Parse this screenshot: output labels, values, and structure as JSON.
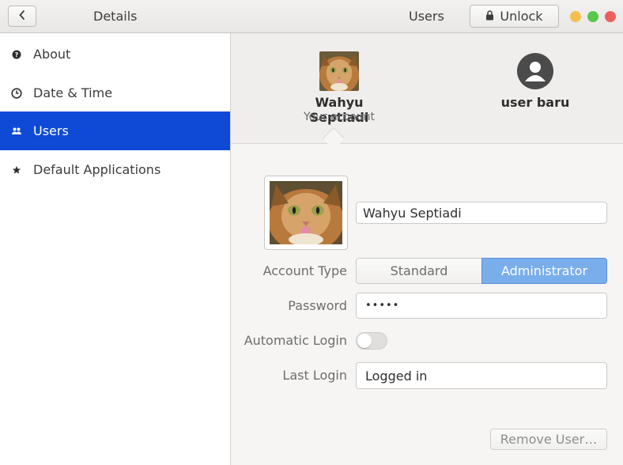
{
  "header": {
    "back_icon": "chevron-left-icon",
    "panel_title": "Details",
    "page_title": "Users",
    "unlock_label": "Unlock",
    "lock_icon": "lock-icon",
    "window_controls": {
      "minimize_color": "#f4bf4f",
      "maximize_color": "#58c84a",
      "close_color": "#ec5f5f"
    }
  },
  "sidebar": {
    "selected_color": "#0e4ad6",
    "items": [
      {
        "label": "About",
        "icon": "help-circle-icon"
      },
      {
        "label": "Date & Time",
        "icon": "clock-icon"
      },
      {
        "label": "Users",
        "icon": "people-icon",
        "selected": true
      },
      {
        "label": "Default Applications",
        "icon": "star-icon"
      }
    ]
  },
  "users": [
    {
      "name": "Wahyu Septiadi",
      "subtitle": "Your account",
      "avatar": "cat-photo"
    },
    {
      "name": "user baru",
      "subtitle": "",
      "avatar": "generic-user-icon"
    }
  ],
  "account": {
    "full_name": "Wahyu Septiadi",
    "account_type_label": "Account Type",
    "account_types": [
      "Standard",
      "Administrator"
    ],
    "account_type_selected": "Administrator",
    "password_label": "Password",
    "password_value": "•••••",
    "automatic_login_label": "Automatic Login",
    "automatic_login_on": false,
    "last_login_label": "Last Login",
    "last_login_value": "Logged in",
    "remove_button_label": "Remove User…"
  }
}
